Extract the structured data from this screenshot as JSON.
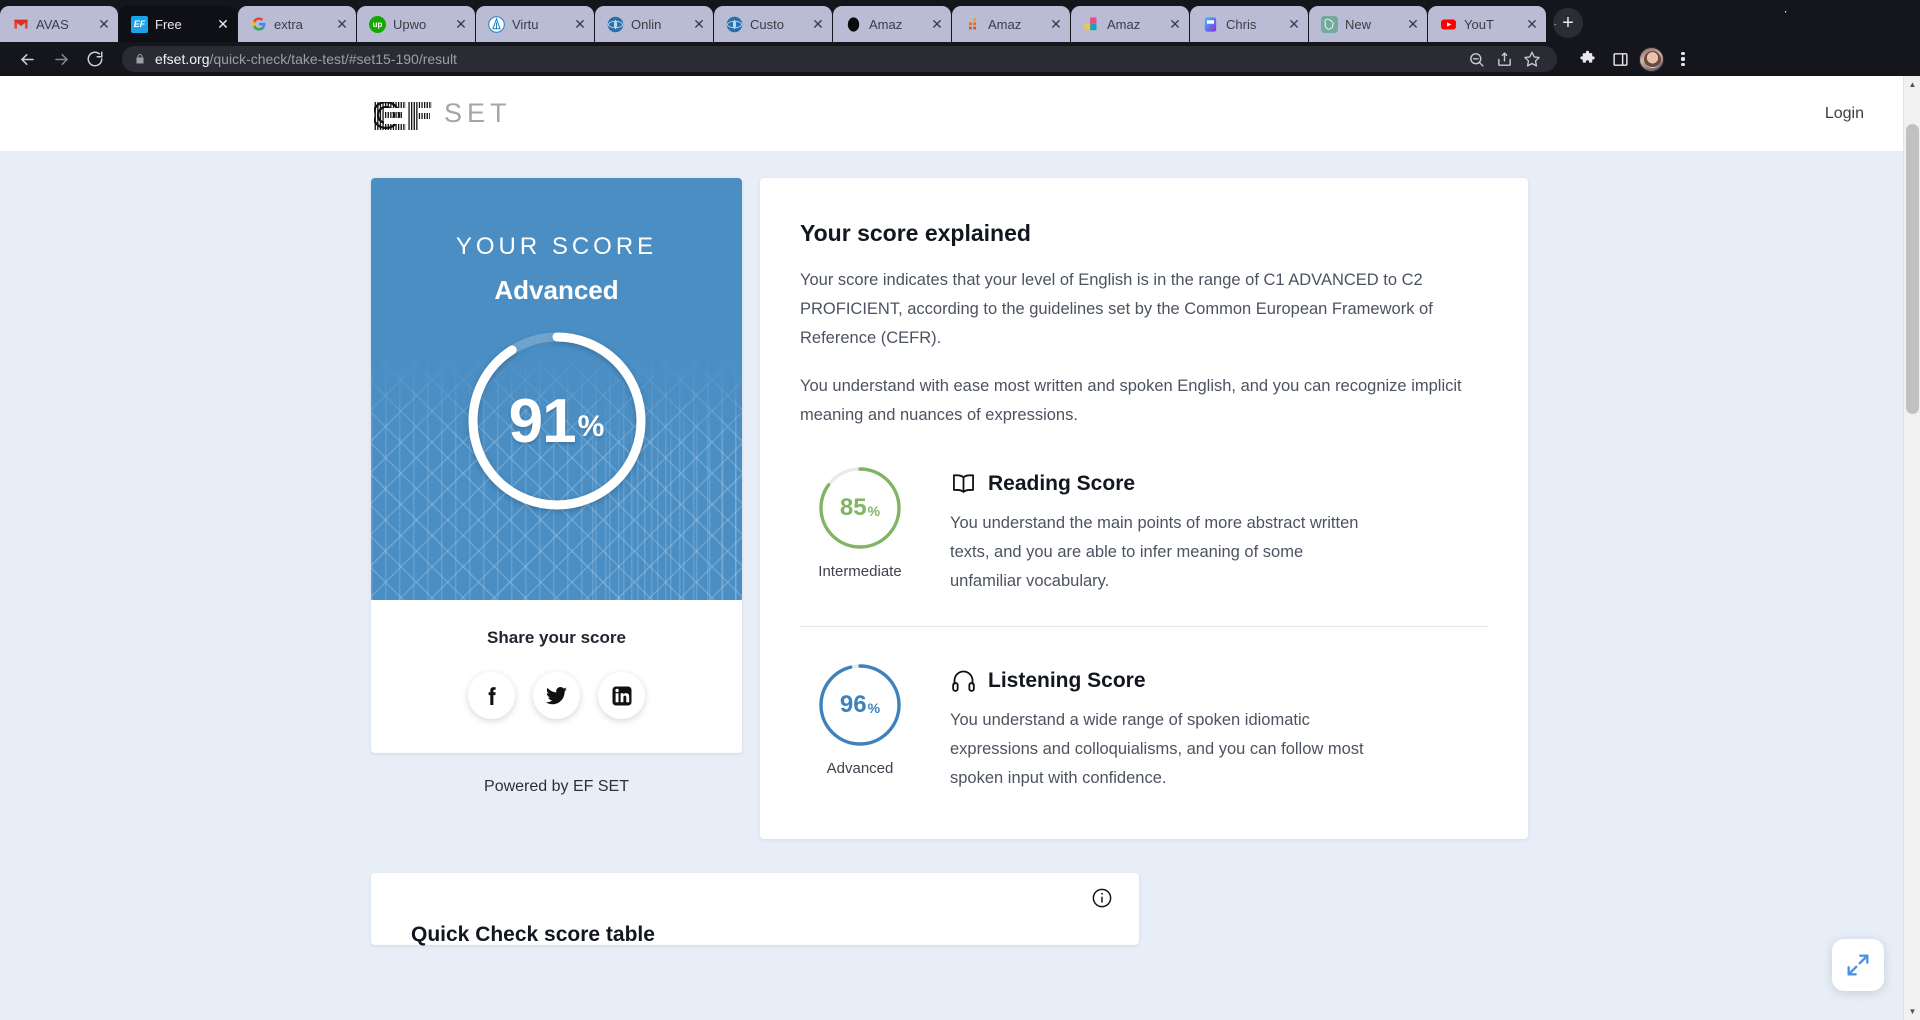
{
  "browser": {
    "tabs": [
      {
        "title": "AVAS",
        "favicon": "gmail-icon",
        "active": false
      },
      {
        "title": "Free",
        "favicon": "efset-icon",
        "active": true
      },
      {
        "title": "extra",
        "favicon": "google-icon",
        "active": false
      },
      {
        "title": "Upwo",
        "favicon": "upwork-icon",
        "active": false
      },
      {
        "title": "Virtu",
        "favicon": "virtual-icon",
        "active": false
      },
      {
        "title": "Onlin",
        "favicon": "online-icon",
        "active": false
      },
      {
        "title": "Custo",
        "favicon": "custom-icon",
        "active": false
      },
      {
        "title": "Amaz",
        "favicon": "black-circle-icon",
        "active": false
      },
      {
        "title": "Amaz",
        "favicon": "orange-squares-icon",
        "active": false
      },
      {
        "title": "Amaz",
        "favicon": "colorblocks-icon",
        "active": false
      },
      {
        "title": "Chris",
        "favicon": "gradient-icon",
        "active": false
      },
      {
        "title": "New",
        "favicon": "chatgpt-icon",
        "active": false
      },
      {
        "title": "YouT",
        "favicon": "youtube-icon",
        "active": false
      }
    ],
    "tab_close_label": "✕",
    "new_tab_label": "+",
    "nav": {
      "back_label": "←",
      "forward_label": "→",
      "reload_label": "↻"
    },
    "omnibox": {
      "lock_icon": "lock-icon",
      "url_domain": "efset.org",
      "url_path": "/quick-check/take-test/#set15-190/result"
    },
    "toolbar_icons": [
      "zoom-out-icon",
      "share-icon",
      "bookmark-star-icon",
      "extensions-puzzle-icon",
      "side-panel-icon",
      "profile-avatar",
      "menu-dots-icon"
    ]
  },
  "site": {
    "logo_text": "SET",
    "logo_mark": "EF",
    "login_label": "Login"
  },
  "score_card": {
    "label": "YOUR SCORE",
    "level": "Advanced",
    "percent": "91",
    "percent_symbol": "%",
    "percent_value": 91,
    "share_title": "Share your score",
    "share_buttons": [
      {
        "name": "facebook-icon",
        "label": "Facebook"
      },
      {
        "name": "twitter-icon",
        "label": "Twitter"
      },
      {
        "name": "linkedin-icon",
        "label": "LinkedIn"
      }
    ],
    "powered_by": "Powered by EF SET",
    "accent_color": "#4a8ec4"
  },
  "explain": {
    "title": "Your score explained",
    "paragraph_1": "Your score indicates that your level of English is in the range of C1 ADVANCED to C2 PROFICIENT, according to the guidelines set by the Common European Framework of Reference (CEFR).",
    "paragraph_2": "You understand with ease most written and spoken English, and you can recognize implicit meaning and nuances of expressions.",
    "skills": [
      {
        "name": "Reading Score",
        "icon": "book-icon",
        "percent": "85",
        "percent_symbol": "%",
        "percent_value": 85,
        "level": "Intermediate",
        "color": "#81b463",
        "description": "You understand the main points of more abstract written texts, and you are able to infer meaning of some unfamiliar vocabulary."
      },
      {
        "name": "Listening Score",
        "icon": "headphones-icon",
        "percent": "96",
        "percent_symbol": "%",
        "percent_value": 96,
        "level": "Advanced",
        "color": "#3d82bd",
        "description": "You understand a wide range of spoken idiomatic expressions and colloquialisms, and you can follow most spoken input with confidence."
      }
    ]
  },
  "score_table": {
    "title": "Quick Check score table",
    "info_icon": "info-icon"
  },
  "widgets": {
    "fullscreen_icon": "expand-arrows-icon"
  },
  "scrollbar": {
    "up_arrow": "▲",
    "down_arrow": "▼"
  }
}
